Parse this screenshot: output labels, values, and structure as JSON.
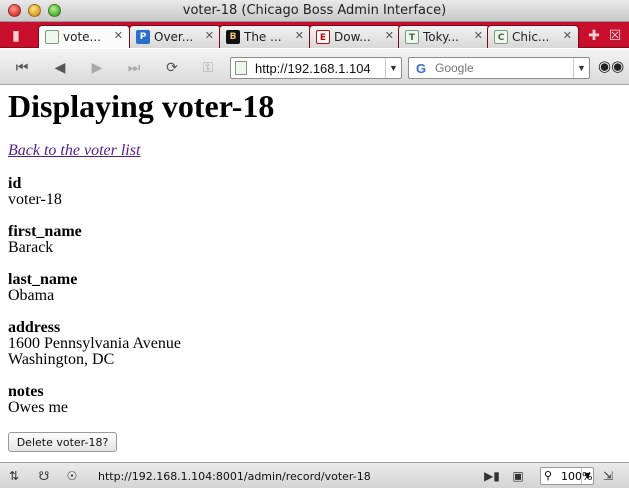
{
  "window": {
    "title": "voter-18 (Chicago Boss Admin Interface)"
  },
  "tabs": [
    {
      "title": "vote...",
      "favicon": "P",
      "active": true
    },
    {
      "title": "Over...",
      "favicon": "P",
      "active": false
    },
    {
      "title": "The ...",
      "favicon": "B",
      "active": false
    },
    {
      "title": "Dow...",
      "favicon": "E",
      "active": false
    },
    {
      "title": "Toky...",
      "favicon": "T",
      "active": false
    },
    {
      "title": "Chic...",
      "favicon": "C",
      "active": false
    }
  ],
  "toolbar": {
    "url": "http://192.168.1.104",
    "search_placeholder": "Google",
    "search_engine_icon": "G"
  },
  "page": {
    "heading": "Displaying voter-18",
    "back_link": "Back to the voter list",
    "fields": [
      {
        "label": "id",
        "value": "voter-18"
      },
      {
        "label": "first_name",
        "value": "Barack"
      },
      {
        "label": "last_name",
        "value": "Obama"
      },
      {
        "label": "address",
        "value": "1600 Pennsylvania Avenue\nWashington, DC"
      },
      {
        "label": "notes",
        "value": "Owes me"
      }
    ],
    "delete_button": "Delete voter-18?"
  },
  "statusbar": {
    "url": "http://192.168.1.104:8001/admin/record/voter-18",
    "zoom": "100%"
  },
  "colors": {
    "tabstrip": "#c8102e",
    "visited_link": "#551a8b"
  }
}
